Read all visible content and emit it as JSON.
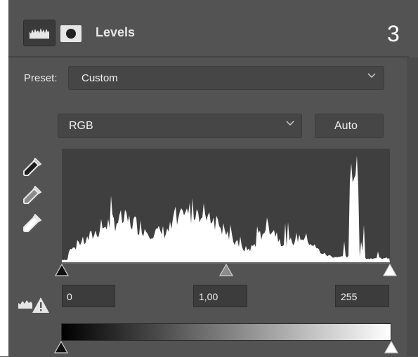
{
  "header": {
    "title": "Levels",
    "step_number": "3",
    "icons": [
      "levels-adjustment-icon",
      "layer-mask-icon"
    ]
  },
  "preset": {
    "label": "Preset:",
    "value": "Custom"
  },
  "channel": {
    "value": "RGB"
  },
  "auto_button": {
    "label": "Auto"
  },
  "eyedroppers": [
    "black-point-eyedropper-icon",
    "gray-point-eyedropper-icon",
    "white-point-eyedropper-icon"
  ],
  "input_levels": {
    "shadows": "0",
    "midtones": "1,00",
    "highlights": "255"
  },
  "output_levels": {
    "shadow_fraction": 0.0,
    "highlight_fraction": 1.0
  },
  "input_slider_fractions": {
    "shadows": 0.0,
    "midtones": 0.5,
    "highlights": 1.0
  },
  "colors": {
    "panel": "#535353",
    "field": "#464646",
    "histogram_bg": "#3f3f3f",
    "histogram_fill": "#ffffff"
  }
}
